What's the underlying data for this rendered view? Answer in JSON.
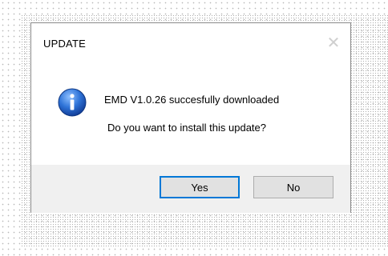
{
  "dialog": {
    "title": "UPDATE",
    "close_glyph": "✕",
    "icon": "information-icon",
    "message_line1": "EMD V1.0.26 succesfully downloaded",
    "message_line2": "Do you want to install this update?",
    "buttons": {
      "yes": "Yes",
      "no": "No"
    },
    "colors": {
      "icon_blue": "#1f5fbf",
      "focus_border": "#0078d7",
      "footer_bg": "#f0f0f0"
    }
  }
}
